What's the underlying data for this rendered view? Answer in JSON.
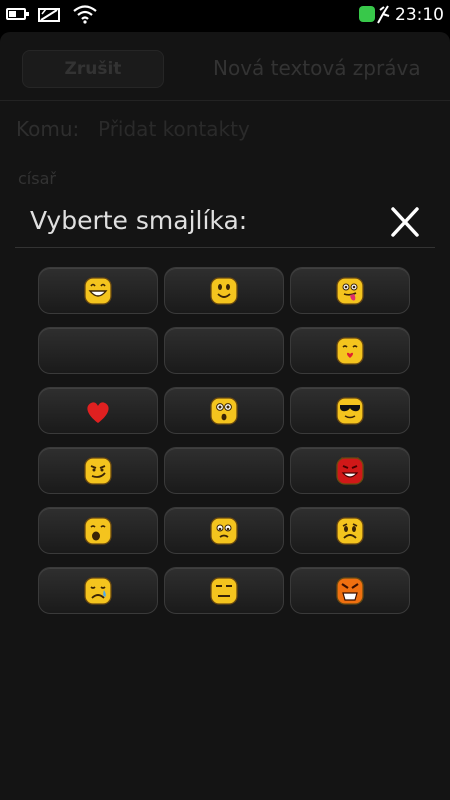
{
  "status_bar": {
    "clock": "23:10",
    "battery_level": 0.5,
    "icons": [
      "battery-icon",
      "sim-disabled-icon",
      "wifi-icon",
      "network-indicator-icon",
      "usb-icon"
    ],
    "network_color": "#38c84a"
  },
  "app": {
    "cancel_label": "Zrušit",
    "title": "Nová textová zpráva",
    "to_label": "Komu:",
    "to_placeholder": "Přidat kontakty",
    "recipient": "císař"
  },
  "picker": {
    "title": "Vyberte smajlíka:",
    "close_icon": "close-icon",
    "rows": [
      [
        "grin",
        "smile",
        "tongue"
      ],
      [
        "",
        "",
        "kiss"
      ],
      [
        "heart",
        "surprised",
        "sunglasses"
      ],
      [
        "smirk",
        "",
        "devil"
      ],
      [
        "yawn",
        "worried",
        "sad"
      ],
      [
        "crying",
        "flat",
        "angry"
      ]
    ]
  },
  "colors": {
    "emoji_yellow": "#f4c41e",
    "emoji_outline": "#6b4a10",
    "heart_red": "#e02020",
    "devil_red": "#d01818",
    "angry_orange": "#f07010"
  }
}
